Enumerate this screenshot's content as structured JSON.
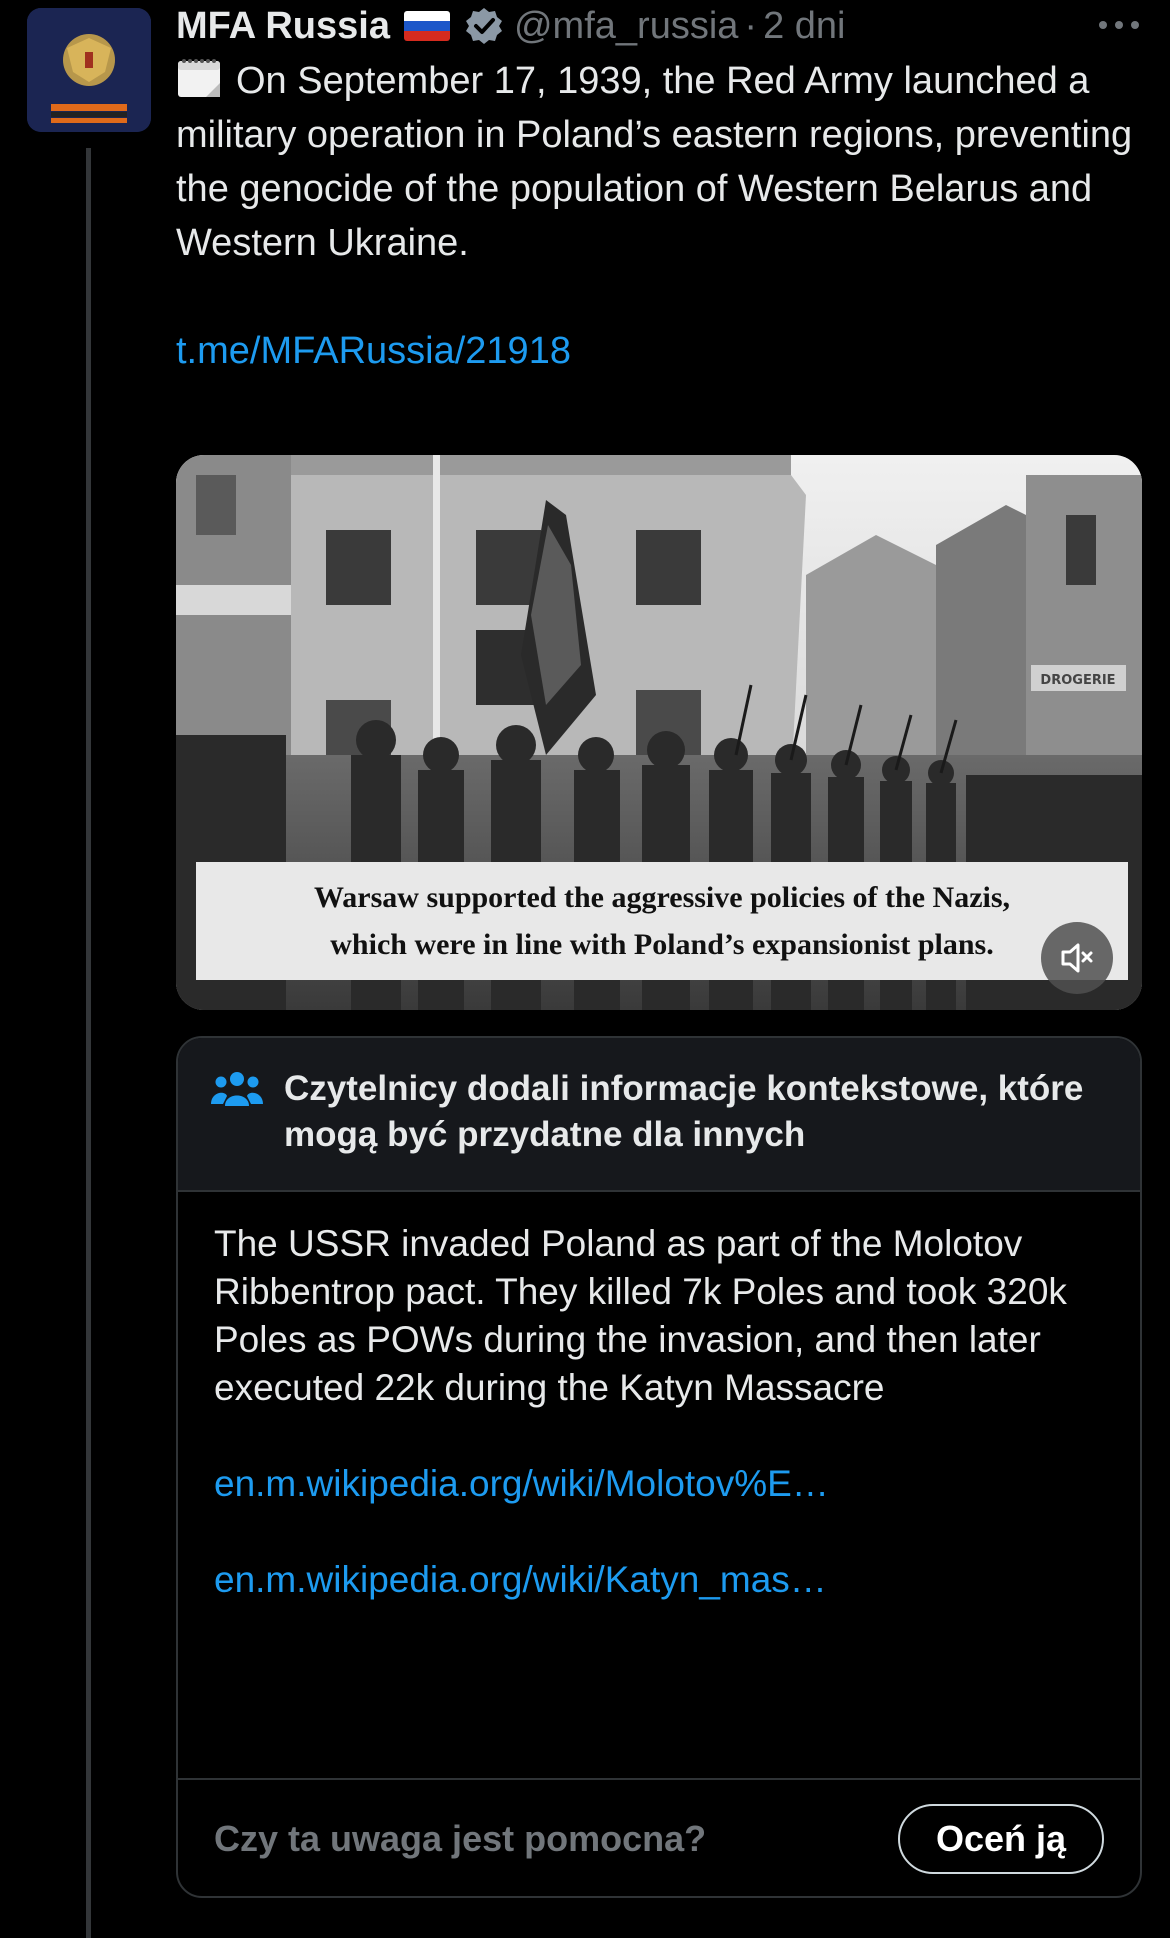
{
  "colors": {
    "background": "#000000",
    "text": "#e7e9ea",
    "muted": "#71767b",
    "link": "#1d9bf0",
    "border": "#2f3336",
    "note_header_bg": "#16181c",
    "verified": "#8b98a5"
  },
  "tweet": {
    "author_name": "MFA Russia",
    "flag_icon": "russia-flag-icon",
    "verified_icon": "verified-badge-icon",
    "handle": "@mfa_russia",
    "separator": "·",
    "time": "2 dni",
    "more_icon": "more-dots-icon",
    "calendar_icon": "calendar-icon",
    "text": "On September 17, 1939, the Red Army launched a military operation in Poland’s eastern regions, preventing the genocide of the population of Western Belarus and Western Ukraine.",
    "link": "t.me/MFARussia/21918"
  },
  "media": {
    "caption_line1": "Warsaw supported the aggressive policies of the Nazis,",
    "caption_line2": "which were in line with Poland’s expansionist plans.",
    "mute_icon": "volume-muted-icon",
    "storefront_sign": "DROGERIE"
  },
  "community_note": {
    "icon": "people-icon",
    "title": "Czytelnicy dodali informacje kontekstowe, które mogą być przydatne dla innych",
    "text": "The USSR invaded Poland as part of the Molotov Ribbentrop pact. They killed 7k Poles and took 320k Poles as POWs during the invasion, and then later executed 22k during the Katyn Massacre",
    "links": [
      "en.m.wikipedia.org/wiki/Molotov%E…",
      "en.m.wikipedia.org/wiki/Katyn_mas…"
    ],
    "question": "Czy ta uwaga jest pomocna?",
    "rate_button": "Oceń ją"
  }
}
